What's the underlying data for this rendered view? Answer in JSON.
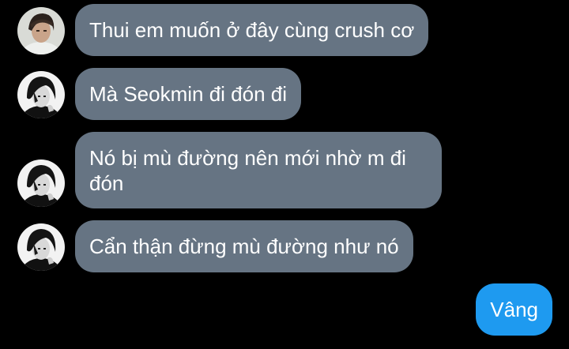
{
  "messages": [
    {
      "sender": "avatar-light",
      "text": "Thui em muốn ở đây cùng crush cơ"
    },
    {
      "sender": "avatar-dark",
      "text": "Mà Seokmin đi đón đi"
    },
    {
      "sender": "avatar-dark",
      "text": "Nó bị mù đường nên mới nhờ m đi đón"
    },
    {
      "sender": "avatar-dark",
      "text": "Cẩn thận đừng mù đường như nó"
    },
    {
      "sender": "me",
      "text": "Vâng"
    }
  ],
  "colors": {
    "background": "#000000",
    "received_bubble": "#667483",
    "sent_bubble": "#1e9af0",
    "text": "#ffffff"
  }
}
